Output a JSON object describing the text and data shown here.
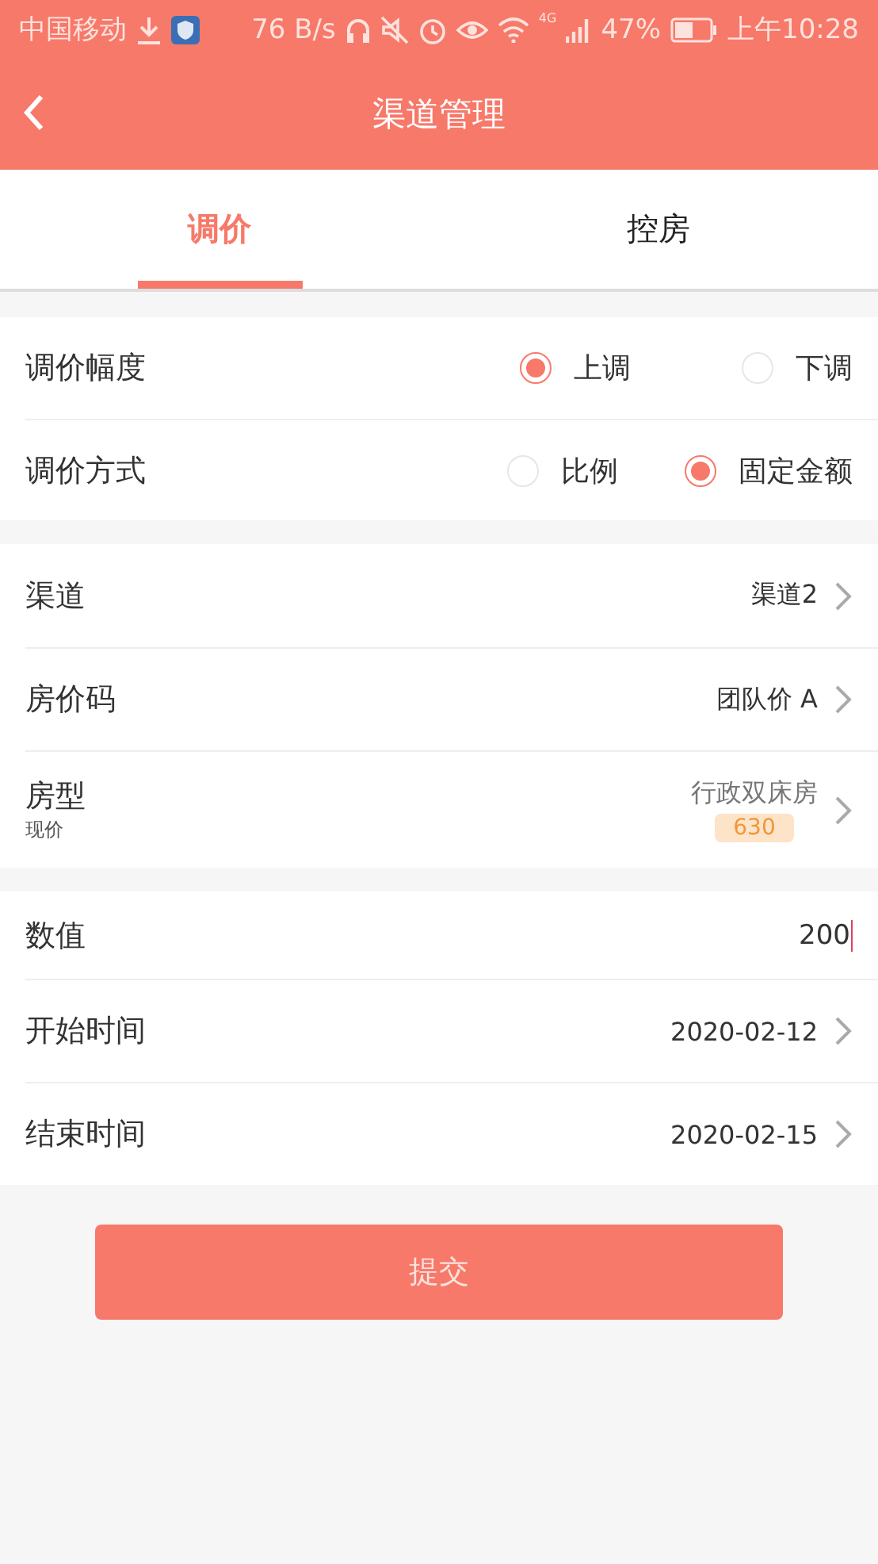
{
  "status_bar": {
    "carrier": "中国移动",
    "speed": "76 B/s",
    "network": "4G",
    "battery": "47%",
    "time": "上午10:28"
  },
  "header": {
    "title": "渠道管理"
  },
  "tabs": [
    {
      "label": "调价",
      "selected": true
    },
    {
      "label": "控房",
      "selected": false
    }
  ],
  "radio_groups": [
    {
      "label": "调价幅度",
      "options": [
        {
          "label": "上调",
          "selected": true
        },
        {
          "label": "下调",
          "selected": false
        }
      ]
    },
    {
      "label": "调价方式",
      "options": [
        {
          "label": "比例",
          "selected": false
        },
        {
          "label": "固定金额",
          "selected": true
        }
      ]
    }
  ],
  "select_rows": [
    {
      "label": "渠道",
      "value": "渠道2"
    },
    {
      "label": "房价码",
      "value": "团队价 A"
    },
    {
      "label": "房型",
      "sublabel": "现价",
      "value": "行政双床房",
      "badge": "630"
    }
  ],
  "detail_rows": [
    {
      "kind": "input",
      "label": "数值",
      "value": "200"
    },
    {
      "kind": "select",
      "label": "开始时间",
      "value": "2020-02-12"
    },
    {
      "kind": "select",
      "label": "结束时间",
      "value": "2020-02-15"
    }
  ],
  "submit": "提交"
}
